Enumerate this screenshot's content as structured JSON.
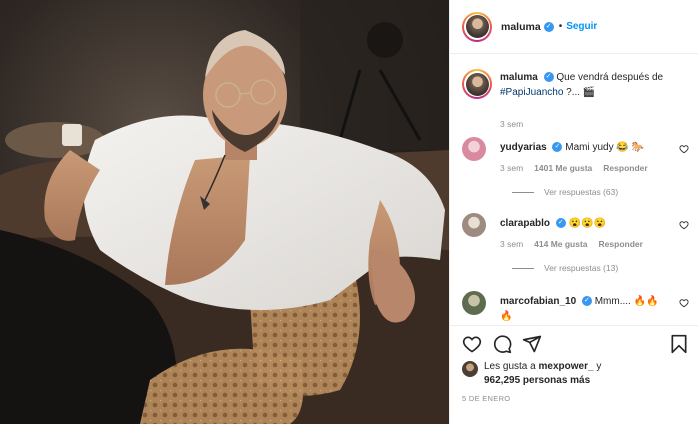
{
  "post": {
    "username": "maluma",
    "follow_label": "Seguir",
    "dot": "•",
    "verified_glyph": "✓"
  },
  "caption": {
    "username": "maluma",
    "text": "Que vendrá después de",
    "hashtag": "#PapiJuancho",
    "suffix": "?...",
    "emoji": "🎬",
    "time": "3 sem"
  },
  "comments": [
    {
      "username": "yudyarias",
      "text": "Mami yudy 😂 🐎",
      "time": "3 sem",
      "likes": "1401 Me gusta",
      "reply": "Responder",
      "view_replies": "Ver respuestas (63)",
      "avatar_color": "#e8a7b8"
    },
    {
      "username": "clarapablo",
      "text": "😮😮😮",
      "time": "3 sem",
      "likes": "414 Me gusta",
      "reply": "Responder",
      "view_replies": "Ver respuestas (13)",
      "avatar_color": "#c7b9ad"
    },
    {
      "username": "marcofabian_10",
      "text": "Mmm.... 🔥🔥",
      "text2": "🔥",
      "avatar_color": "#7a8a6a"
    }
  ],
  "likes": {
    "line1_prefix": "Les gusta a",
    "line1_user": "mexpower_",
    "line1_suffix": "y",
    "line2": "962,295 personas más"
  },
  "date": "5 DE ENERO",
  "icons": {
    "heart": "heart-icon",
    "comment": "comment-icon",
    "share": "share-icon",
    "save": "bookmark-icon"
  },
  "colors": {
    "accent": "#0095f6",
    "verified": "#3897f0",
    "muted": "#8e8e8e",
    "hashtag": "#00376b"
  }
}
